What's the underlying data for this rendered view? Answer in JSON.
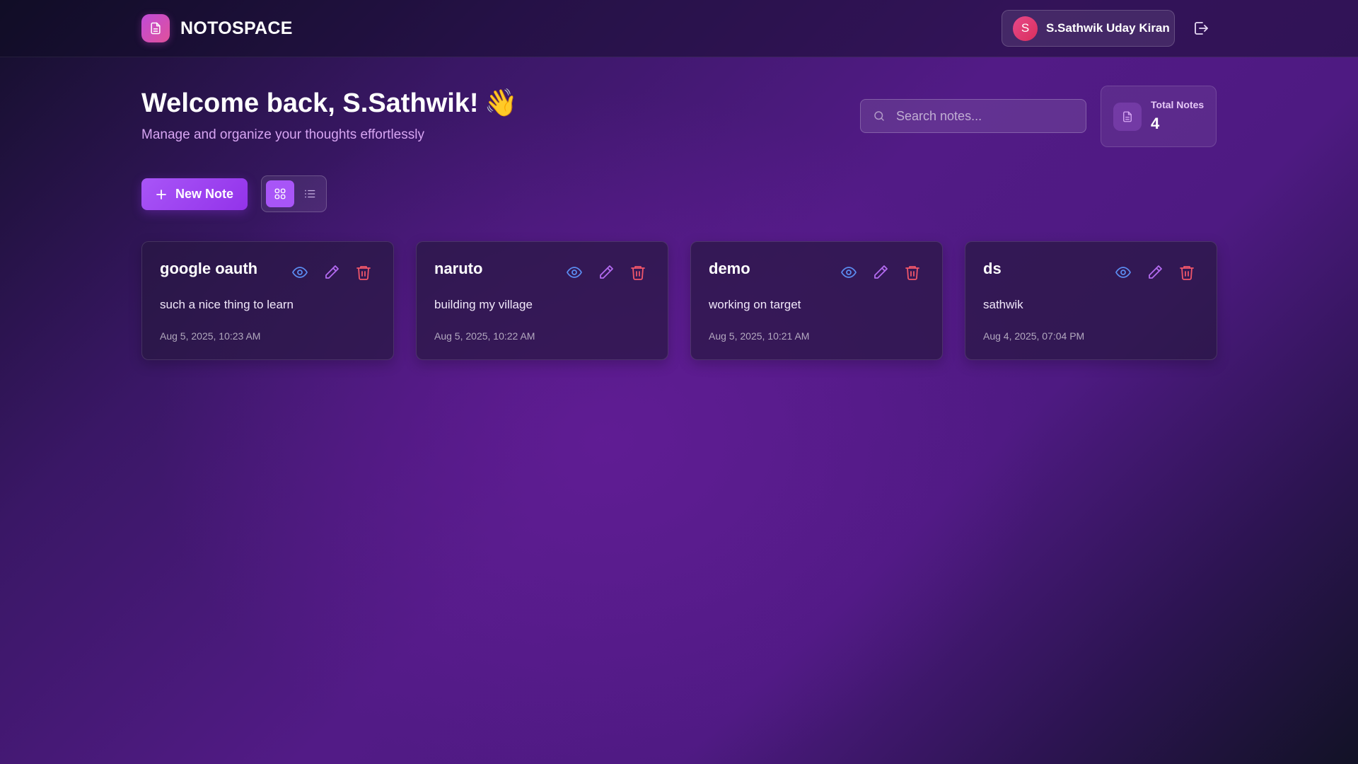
{
  "header": {
    "brand_name": "NOTOSPACE",
    "user_initial": "S",
    "user_name": "S.Sathwik Uday Kiran"
  },
  "welcome": {
    "title": "Welcome back, S.Sathwik!",
    "emoji": "👋",
    "subtitle": "Manage and organize your thoughts effortlessly"
  },
  "search": {
    "placeholder": "Search notes..."
  },
  "stats": {
    "total_label": "Total Notes",
    "total_count": "4"
  },
  "toolbar": {
    "new_note_label": "New Note",
    "active_view": "grid"
  },
  "notes": [
    {
      "title": "google oauth",
      "content": "such a nice thing to learn",
      "date": "Aug 5, 2025, 10:23 AM"
    },
    {
      "title": "naruto",
      "content": "building my village",
      "date": "Aug 5, 2025, 10:22 AM"
    },
    {
      "title": "demo",
      "content": "working on target",
      "date": "Aug 5, 2025, 10:21 AM"
    },
    {
      "title": "ds",
      "content": "sathwik",
      "date": "Aug 4, 2025, 07:04 PM"
    }
  ],
  "colors": {
    "accent": "#a855f7",
    "view_icon": "#5b8cf0",
    "edit_icon": "#b36af0",
    "delete_icon": "#f0566a"
  },
  "icons": {
    "logo": "document-icon",
    "logout": "logout-icon",
    "search": "search-icon",
    "grid": "grid-icon",
    "list": "list-icon",
    "view": "eye-icon",
    "edit": "pencil-icon",
    "delete": "trash-icon"
  }
}
